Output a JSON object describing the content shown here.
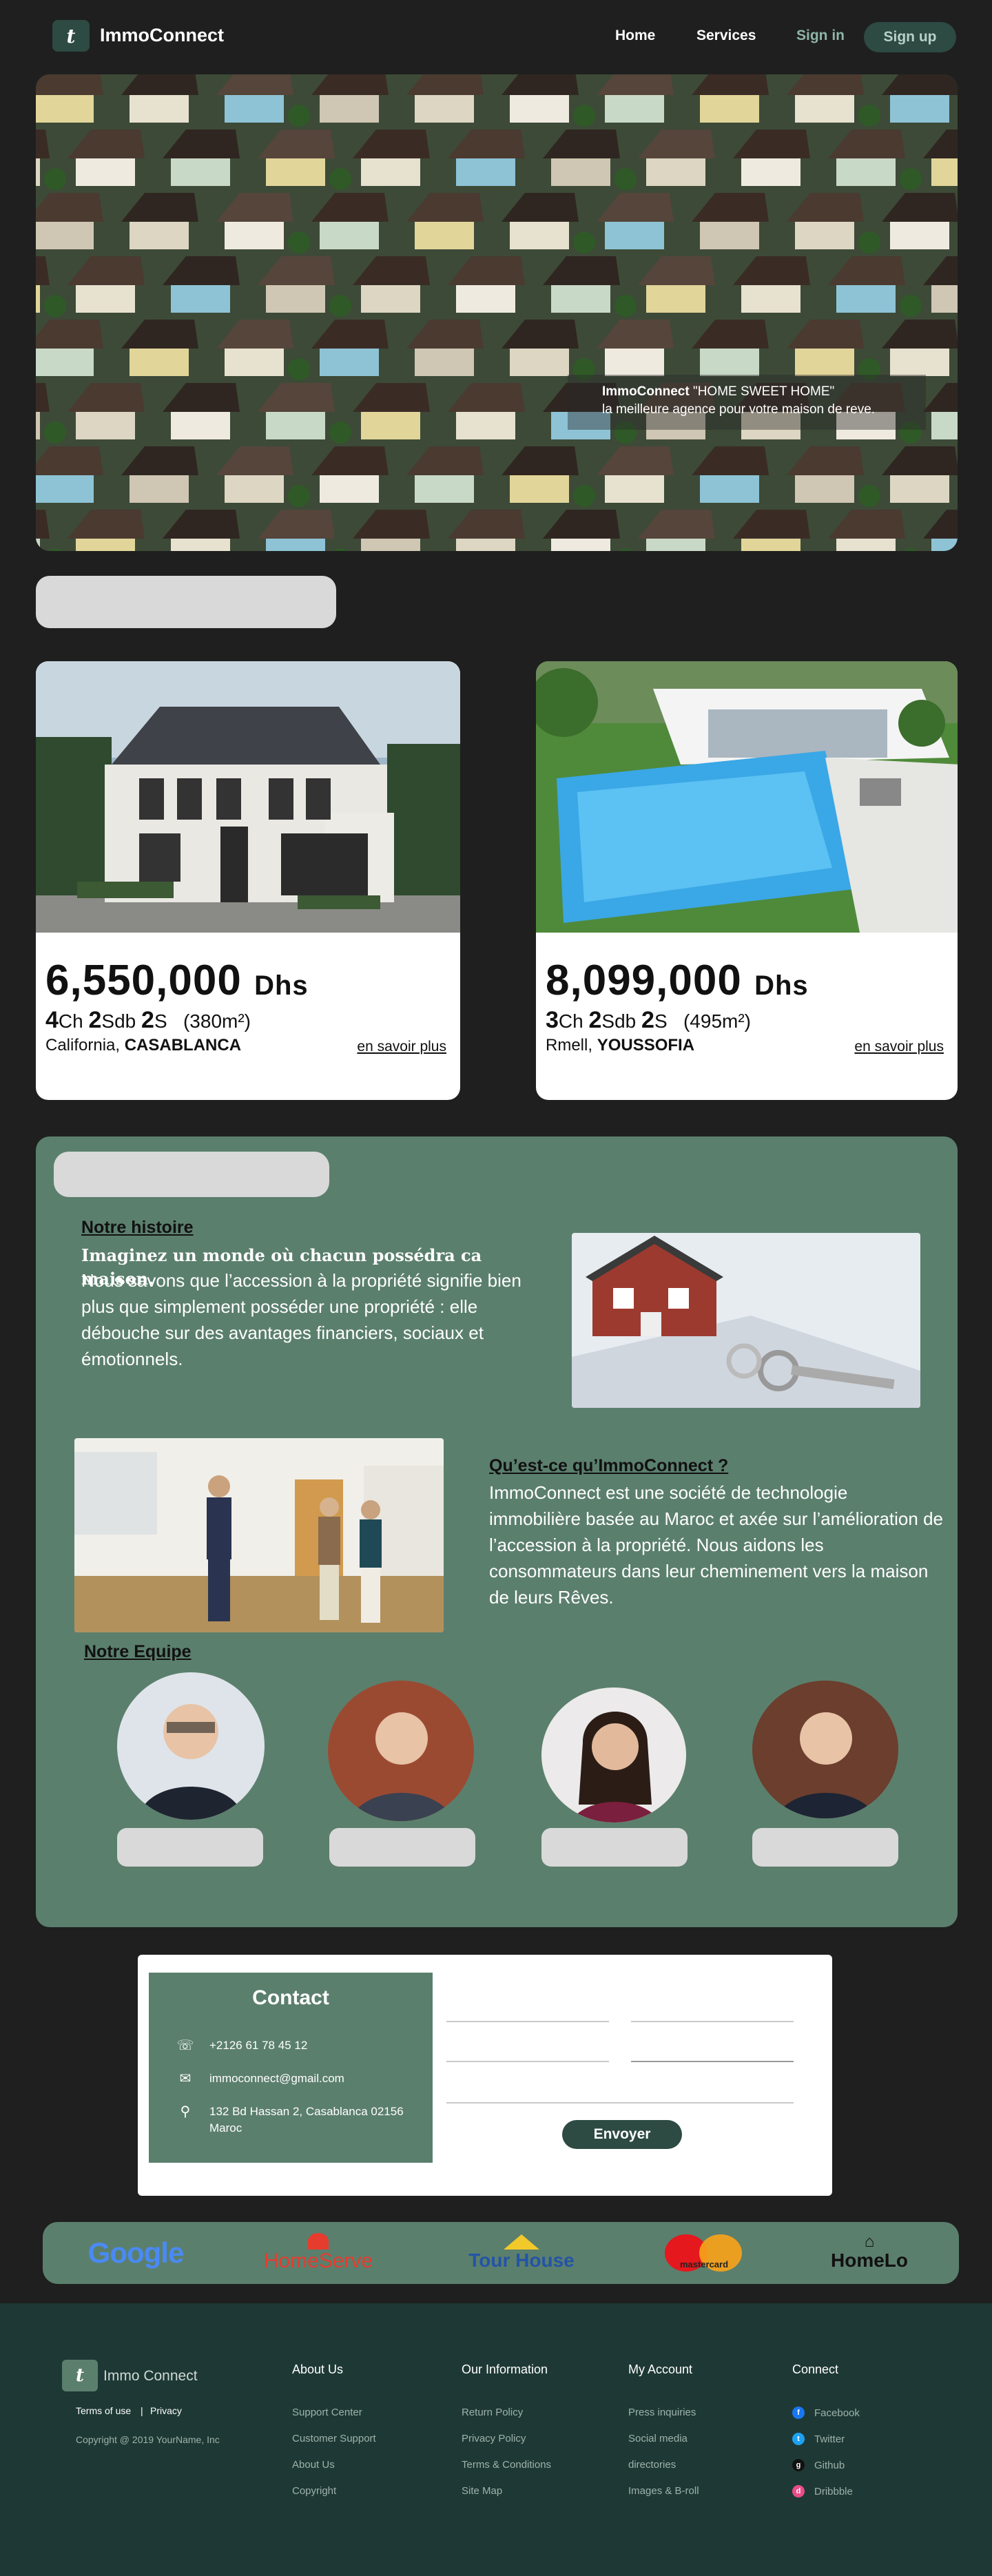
{
  "nav": {
    "brand": "ImmoConnect",
    "logo_glyph": "t",
    "links": [
      "Home",
      "Services",
      "Sign in"
    ],
    "signup": "Sign up"
  },
  "hero": {
    "brand": "ImmoConnect",
    "tagline": "\"HOME SWEET HOME\"",
    "subtitle": "la meilleure agence pour votre maison de reve."
  },
  "listings": [
    {
      "price": "6,550,000",
      "currency": "Dhs",
      "ch": "4",
      "sdb": "2",
      "s": "2",
      "area": "(380m²)",
      "city": "California,",
      "district": "CASABLANCA",
      "link": "en savoir plus"
    },
    {
      "price": "8,099,000",
      "currency": "Dhs",
      "ch": "3",
      "sdb": "2",
      "s": "2",
      "area": "(495m²)",
      "city": "Rmell,",
      "district": "YOUSSOFIA",
      "link": "en savoir plus"
    }
  ],
  "spec_labels": {
    "ch": "Ch",
    "sdb": "Sdb",
    "s": "S"
  },
  "about": {
    "story_title": "Notre histoire",
    "story_lead": "Imaginez un monde où chacun possédra ca maison.",
    "story_body": "Nous savons que l’accession à la propriété signifie bien plus que simplement posséder une propriété : elle débouche sur des avantages financiers, sociaux et émotionnels.",
    "what_title": "Qu’est-ce qu’ImmoConnect ?",
    "what_body": "ImmoConnect est une société de technologie immobilière basée au Maroc et axée sur l’amélioration de l’accession à la propriété. Nous aidons les consommateurs dans leur cheminement vers la maison de leurs Rêves.",
    "team_title": "Notre Equipe"
  },
  "contact": {
    "title": "Contact",
    "phone": "+2126 61 78 45 12",
    "email": "immoconnect@gmail.com",
    "address": "132 Bd Hassan 2, Casablanca 02156 Maroc",
    "send": "Envoyer"
  },
  "partners": [
    "Google",
    "HomeServe",
    "Tour House",
    "mastercard",
    "HomeLo"
  ],
  "footer": {
    "brand": "Immo Connect",
    "terms": "Terms of use",
    "sep": "|",
    "privacy": "Privacy",
    "copyright": "Copyright @ 2019 YourName, Inc",
    "columns": [
      {
        "title": "About Us",
        "items": [
          "Support Center",
          "Customer Support",
          "About Us",
          "Copyright"
        ]
      },
      {
        "title": "Our Information",
        "items": [
          "Return Policy",
          "Privacy Policy",
          "Terms & Conditions",
          "Site Map"
        ]
      },
      {
        "title": "My Account",
        "items": [
          "Press inquiries",
          "Social media",
          "directories",
          "Images & B-roll"
        ]
      }
    ],
    "connect_title": "Connect",
    "connect": [
      "Facebook",
      "Twitter",
      "Github",
      "Dribbble"
    ]
  }
}
